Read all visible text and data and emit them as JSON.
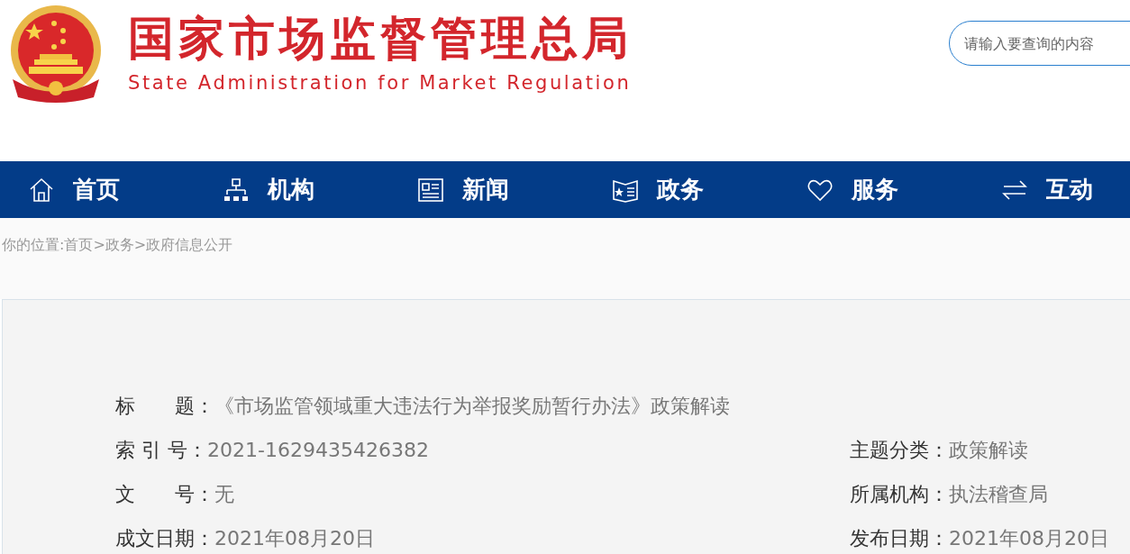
{
  "header": {
    "title": "国家市场监督管理总局",
    "subtitle": "State Administration for Market Regulation",
    "search": {
      "placeholder": "请输入要查询的内容"
    }
  },
  "nav": [
    {
      "kind": "home",
      "label": "首页"
    },
    {
      "kind": "org",
      "label": "机构"
    },
    {
      "kind": "news",
      "label": "新闻"
    },
    {
      "kind": "affairs",
      "label": "政务"
    },
    {
      "kind": "service",
      "label": "服务"
    },
    {
      "kind": "interact",
      "label": "互动"
    }
  ],
  "breadcrumb": {
    "prefix": "你的位置:",
    "items": [
      "首页",
      "政务",
      "政府信息公开"
    ],
    "separator": ">"
  },
  "details": {
    "left": [
      {
        "label": "标　　题：",
        "value": "《市场监管领域重大违法行为举报奖励暂行办法》政策解读"
      },
      {
        "label": "索 引 号：",
        "value": "2021-1629435426382"
      },
      {
        "label": "文　　号：",
        "value": "无"
      },
      {
        "label": "成文日期：",
        "value": "2021年08月20日"
      }
    ],
    "right": [
      {
        "label": "主题分类：",
        "value": "政策解读"
      },
      {
        "label": "所属机构：",
        "value": "执法稽查局"
      },
      {
        "label": "发布日期：",
        "value": "2021年08月20日"
      }
    ]
  }
}
